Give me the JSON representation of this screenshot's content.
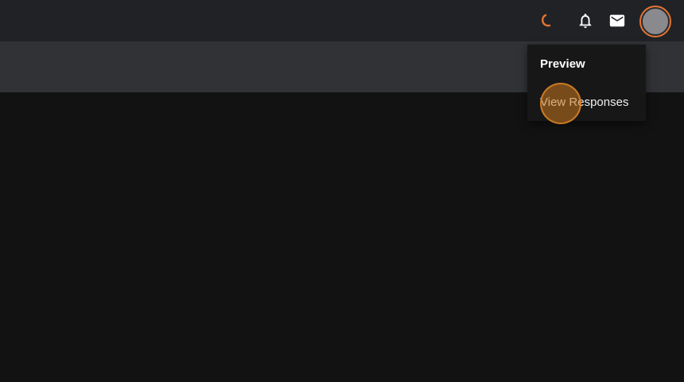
{
  "header": {
    "icons": {
      "spinner": "loading-spinner-icon",
      "bell": "bell-icon",
      "mail": "mail-icon",
      "avatar": "avatar"
    },
    "accent_color": "#e5732f"
  },
  "toolbar": {
    "save_icon": "save-icon"
  },
  "menu": {
    "items": [
      {
        "label": "Preview"
      },
      {
        "label": "View Responses"
      }
    ]
  }
}
